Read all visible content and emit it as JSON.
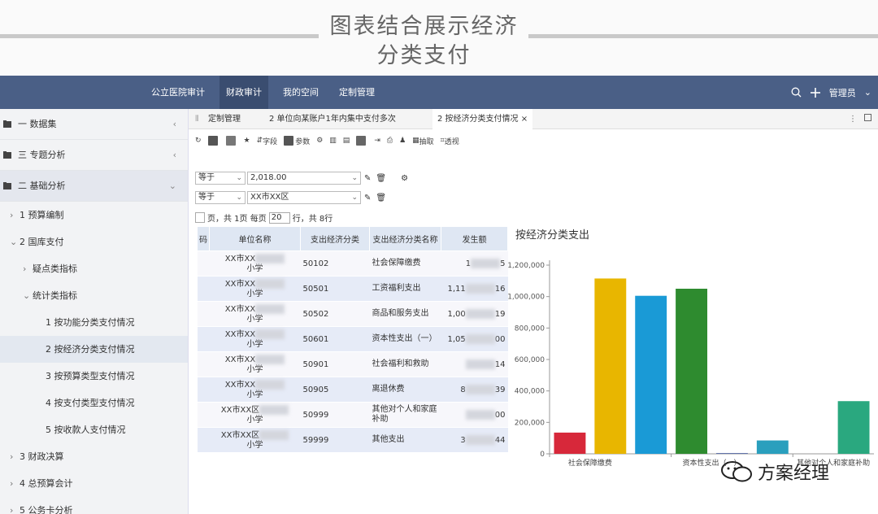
{
  "banner": {
    "line1": "图表结合展示经济",
    "line2": "分类支付"
  },
  "navbar": {
    "items": [
      "公立医院审计",
      "财政审计",
      "我的空间",
      "定制管理"
    ],
    "user": "管理员"
  },
  "sidebar": {
    "groups": [
      {
        "label": "一 数据集",
        "chev": "‹"
      },
      {
        "label": "三 专题分析",
        "chev": "‹"
      },
      {
        "label": "二 基础分析",
        "chev": "⌄"
      }
    ],
    "items": [
      {
        "label": "1 预算编制",
        "arrow": "›"
      },
      {
        "label": "2 国库支付",
        "arrow": "⌄"
      },
      {
        "label": "疑点类指标",
        "arrow": "›"
      },
      {
        "label": "统计类指标",
        "arrow": "⌄"
      },
      {
        "label": "1 按功能分类支付情况",
        "arrow": ""
      },
      {
        "label": "2 按经济分类支付情况",
        "arrow": ""
      },
      {
        "label": "3 按预算类型支付情况",
        "arrow": ""
      },
      {
        "label": "4 按支付类型支付情况",
        "arrow": ""
      },
      {
        "label": "5 按收款人支付情况",
        "arrow": ""
      },
      {
        "label": "3 财政决算",
        "arrow": "›"
      },
      {
        "label": "4 总预算会计",
        "arrow": "›"
      },
      {
        "label": "5 公务卡分析",
        "arrow": "›"
      }
    ]
  },
  "tabs": {
    "items": [
      "定制管理",
      "2 单位向某账户1年内集中支付多次",
      "2 按经济分类支付情况"
    ],
    "close": "×"
  },
  "toolbar": {
    "field": "字段",
    "param": "参数",
    "extract": "抽取",
    "perspective": "透视"
  },
  "filters": {
    "row1": {
      "op": "等于",
      "value": "2,018.00"
    },
    "row2": {
      "op": "等于",
      "value": "XX市XX区"
    }
  },
  "pager": {
    "text1": "页，共 1页 每页",
    "per_page": "20",
    "text2": "行，共 8行"
  },
  "table": {
    "headers": [
      "码",
      "单位名称",
      "支出经济分类",
      "支出经济分类名称",
      "发生额"
    ],
    "rows": [
      {
        "unit_a": "XX市XX",
        "unit_b": "小学",
        "code": "50102",
        "name": "社会保障缴费",
        "amount_pre": "1",
        "amount_suf": "5"
      },
      {
        "unit_a": "XX市XX",
        "unit_b": "小学",
        "code": "50501",
        "name": "工资福利支出",
        "amount_pre": "1,11",
        "amount_suf": "16"
      },
      {
        "unit_a": "XX市XX",
        "unit_b": "小学",
        "code": "50502",
        "name": "商品和服务支出",
        "amount_pre": "1,00",
        "amount_suf": "19"
      },
      {
        "unit_a": "XX市XX",
        "unit_b": "小学",
        "code": "50601",
        "name": "资本性支出（一）",
        "amount_pre": "1,05",
        "amount_suf": "00"
      },
      {
        "unit_a": "XX市XX",
        "unit_b": "小学",
        "code": "50901",
        "name": "社会福利和救助",
        "amount_pre": "",
        "amount_suf": "14"
      },
      {
        "unit_a": "XX市XX",
        "unit_b": "小学",
        "code": "50905",
        "name": "离退休费",
        "amount_pre": "8",
        "amount_suf": "39"
      },
      {
        "unit_a": "XX市XX区",
        "unit_b": "小学",
        "code": "50999",
        "name": "其他对个人和家庭补助",
        "amount_pre": "",
        "amount_suf": "00"
      },
      {
        "unit_a": "XX市XX区",
        "unit_b": "小学",
        "code": "59999",
        "name": "其他支出",
        "amount_pre": "3",
        "amount_suf": "44"
      }
    ]
  },
  "chart_data": {
    "type": "bar",
    "title": "按经济分类支出",
    "categories": [
      "社会保障缴费",
      "工资福利支出",
      "商品和服务支出",
      "资本性支出（一）",
      "社会福利和救助",
      "离退休费",
      "其他对个人和家庭补助",
      "其他支出"
    ],
    "values": [
      135000,
      1115000,
      1005000,
      1050000,
      5000,
      85000,
      0,
      335000
    ],
    "colors": [
      "#d7283a",
      "#e8b600",
      "#1a9ad6",
      "#2e8b2f",
      "#5d6fa8",
      "#2a9fbd",
      "#8a8a8a",
      "#2aa87f"
    ],
    "yticks": [
      "0",
      "200,000",
      "400,000",
      "600,000",
      "800,000",
      "1,000,000",
      "1,200,000"
    ],
    "ylim": [
      0,
      1200000
    ],
    "xtick_labels": [
      "社会保障缴费",
      "资本性支出（一）",
      "其他对个人和家庭补助"
    ],
    "xtick_index": [
      0,
      3,
      6
    ],
    "grid": false
  },
  "watermark": {
    "text": "方案经理"
  }
}
